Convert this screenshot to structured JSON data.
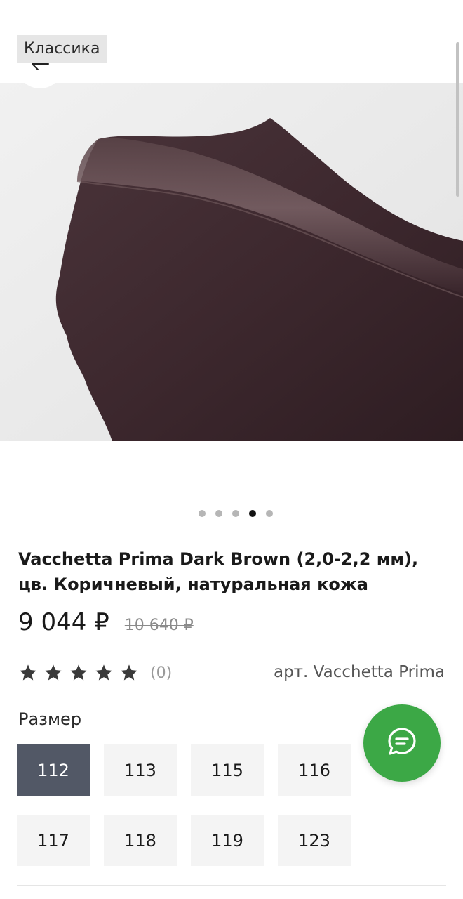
{
  "header": {
    "tag": "Классика"
  },
  "gallery": {
    "total": 5,
    "active_index": 3
  },
  "product": {
    "title": "Vacchetta Prima Dark Brown (2,0-2,2 мм), цв. Коричневый, натуральная кожа",
    "price": "9 044 ₽",
    "old_price": "10 640 ₽",
    "rating": 5,
    "reviews": "(0)",
    "sku": "арт. Vacchetta Prima"
  },
  "sizes": {
    "label": "Размер",
    "items": [
      "112",
      "113",
      "115",
      "116",
      "117",
      "118",
      "119",
      "123"
    ],
    "selected": "112"
  },
  "colors": {
    "chat": "#3ca846",
    "selected_size": "#525866",
    "leather": "#3f2a30"
  },
  "icons": {
    "back": "arrow-left-icon",
    "chat": "chat-bubble-icon",
    "star": "star-icon"
  }
}
